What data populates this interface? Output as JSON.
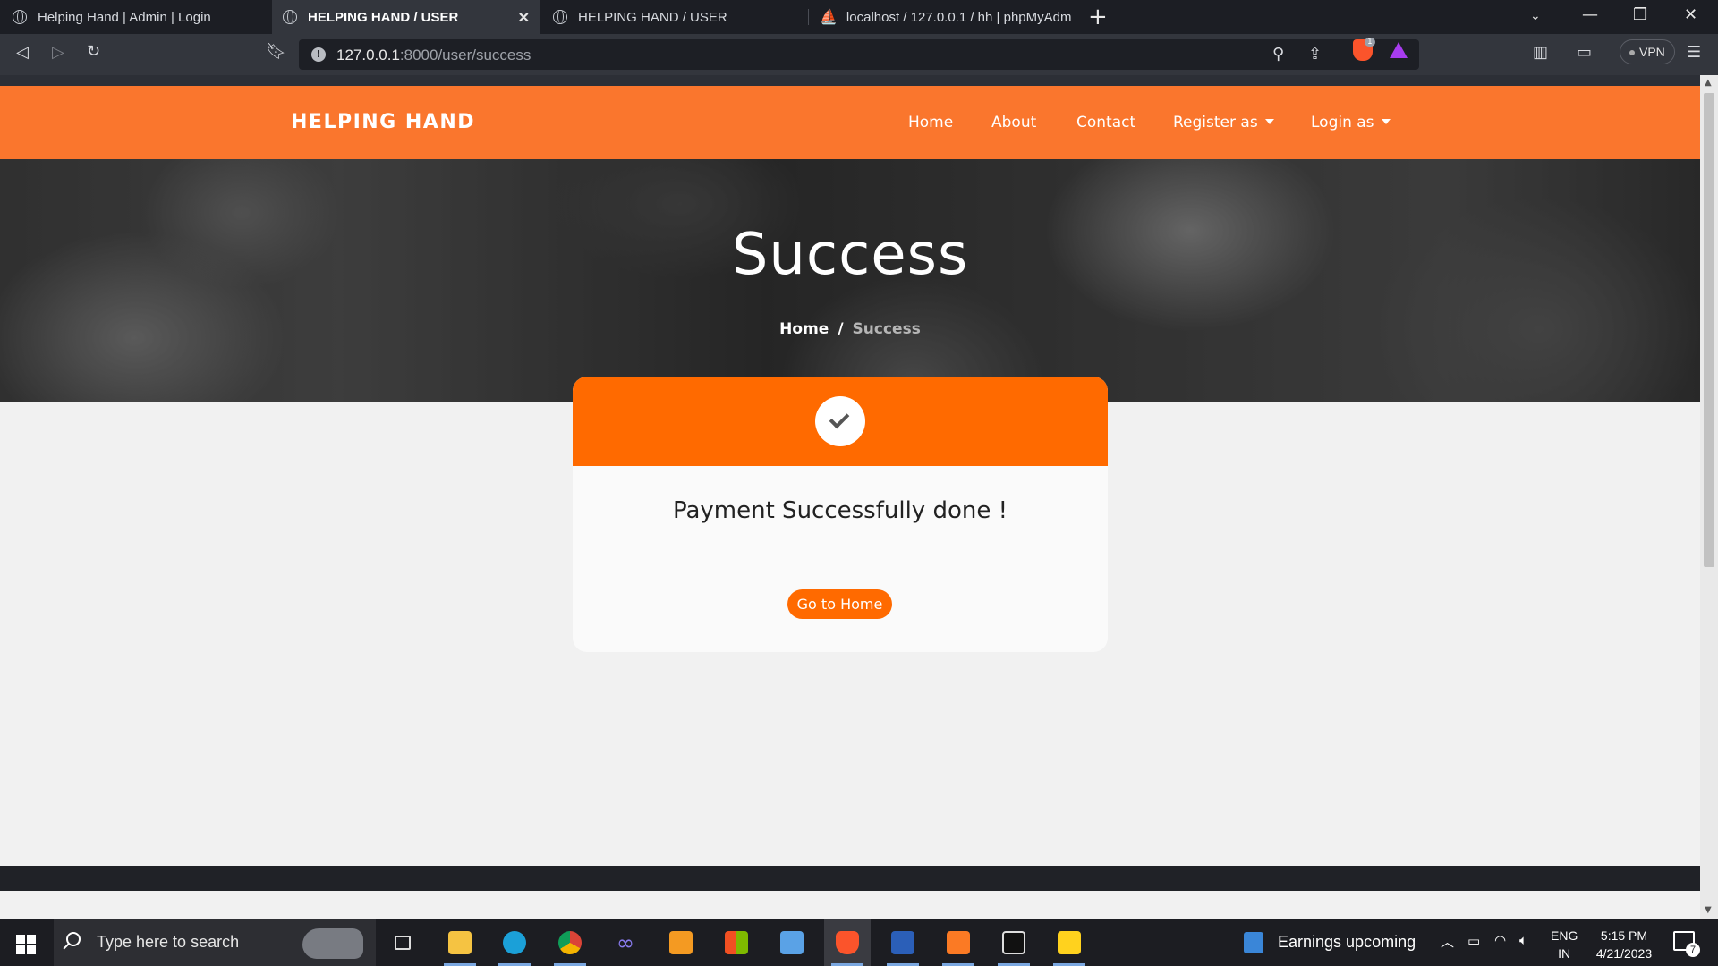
{
  "browser": {
    "tabs": [
      {
        "title": "Helping Hand | Admin | Login",
        "active": false
      },
      {
        "title": "HELPING HAND / USER",
        "active": true
      },
      {
        "title": "HELPING HAND / USER",
        "active": false
      },
      {
        "title": "localhost / 127.0.0.1 / hh | phpMyAdm",
        "active": false
      }
    ],
    "url_host": "127.0.0.1",
    "url_path": ":8000/user/success",
    "vpn_label": "VPN",
    "shields_count": "1"
  },
  "site": {
    "brand": "HELPING HAND",
    "nav": {
      "home": "Home",
      "about": "About",
      "contact": "Contact",
      "register": "Register as",
      "login": "Login as"
    },
    "hero": {
      "title": "Success",
      "breadcrumb_home": "Home",
      "breadcrumb_sep": "/",
      "breadcrumb_current": "Success"
    },
    "card": {
      "message": "Payment Successfully done !",
      "button": "Go to Home"
    }
  },
  "taskbar": {
    "search_placeholder": "Type here to search",
    "news": "Earnings upcoming",
    "lang_top": "ENG",
    "lang_bottom": "IN",
    "time": "5:15 PM",
    "date": "4/21/2023",
    "notification_count": "7"
  },
  "colors": {
    "navbar": "#fa762d",
    "accent": "#ff6a00"
  }
}
